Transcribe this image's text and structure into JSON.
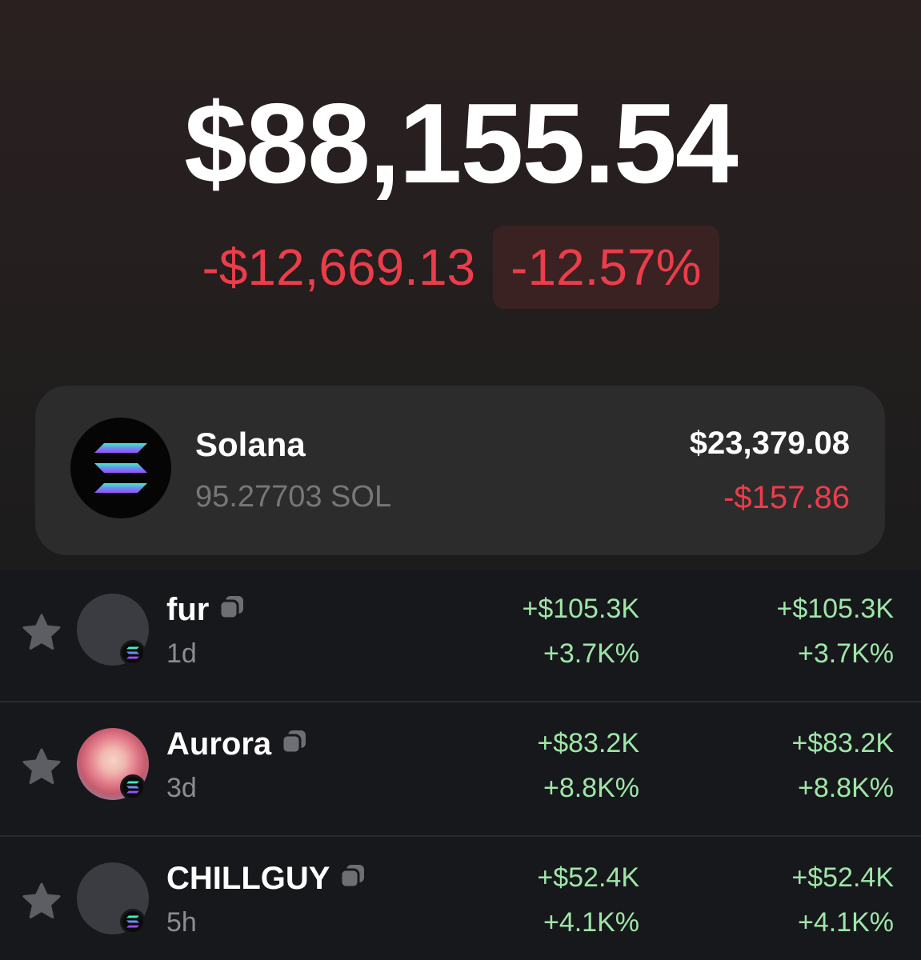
{
  "portfolio": {
    "balance": "$88,155.54",
    "change_abs": "-$12,669.13",
    "change_pct": "-12.57%"
  },
  "solana": {
    "name": "Solana",
    "amount": "95.27703 SOL",
    "value": "$23,379.08",
    "change": "-$157.86"
  },
  "tokens": [
    {
      "name": "fur",
      "age": "1d",
      "col1_value": "+$105.3K",
      "col1_pct": "+3.7K%",
      "col2_value": "+$105.3K",
      "col2_pct": "+3.7K%"
    },
    {
      "name": "Aurora",
      "age": "3d",
      "col1_value": "+$83.2K",
      "col1_pct": "+8.8K%",
      "col2_value": "+$83.2K",
      "col2_pct": "+8.8K%"
    },
    {
      "name": "CHILLGUY",
      "age": "5h",
      "col1_value": "+$52.4K",
      "col1_pct": "+4.1K%",
      "col2_value": "+$52.4K",
      "col2_pct": "+4.1K%"
    }
  ],
  "colors": {
    "negative": "#ec3d4a",
    "positive": "#9ee6a8",
    "card": "#2c2c2c",
    "list_bg": "#17181b"
  },
  "icons": [
    "solana-logo-icon",
    "star-icon",
    "copy-icon",
    "solana-badge-icon"
  ]
}
